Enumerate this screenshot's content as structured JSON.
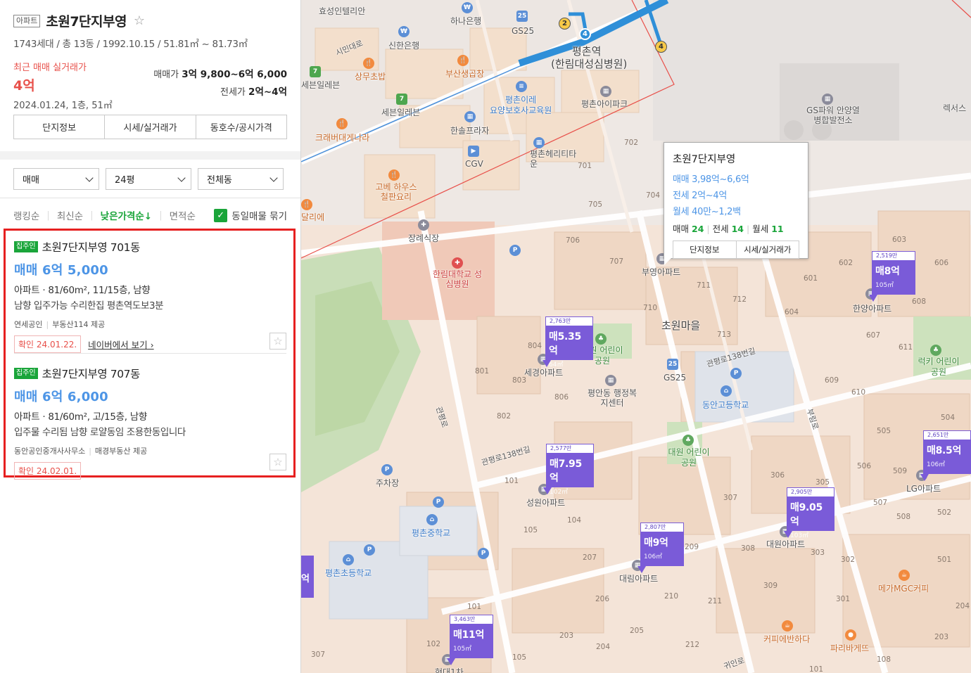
{
  "complex": {
    "type_badge": "아파트",
    "name": "초원7단지부영",
    "meta": "1743세대 / 총 13동 / 1992.10.15 / 51.81㎡ ~ 81.73㎡",
    "recent_label": "최근 매매 실거래가",
    "recent_price": "4억",
    "recent_date": "2024.01.24, 1층, 51㎡",
    "sale_label": "매매가",
    "sale_range": "3억 9,800~6억 6,000",
    "jeonse_label": "전세가",
    "jeonse_range": "2억~4억"
  },
  "tabs": [
    "단지정보",
    "시세/실거래가",
    "동호수/공시가격"
  ],
  "filters": {
    "deal": "매매",
    "size": "24평",
    "building": "전체동"
  },
  "sort": {
    "items": [
      "랭킹순",
      "최신순",
      "낮은가격순↓",
      "면적순"
    ],
    "active_index": 2,
    "same_listing_label": "동일매물 묶기"
  },
  "listings": [
    {
      "badge": "집주인",
      "title": "초원7단지부영 701동",
      "price": "매매 6억 5,000",
      "spec": "아파트 · 81/60m², 11/15층, 남향",
      "desc": "남향 입주가능 수리한집 평촌역도보3분",
      "agent": "연세공인",
      "provider": "부동산114 제공",
      "confirmed": "확인 24.01.22.",
      "link": "네이버에서 보기 ›"
    },
    {
      "badge": "집주인",
      "title": "초원7단지부영 707동",
      "price": "매매 6억 6,000",
      "spec": "아파트 · 81/60m², 고/15층, 남향",
      "desc": "입주물 수리됨 남향 로얄동임 조용한동입니다",
      "agent": "동안공인중개사사무소",
      "provider": "매경부동산 제공",
      "confirmed": "확인 24.02.01.",
      "link": ""
    }
  ],
  "popup": {
    "title": "초원7단지부영",
    "sale": "매매 3,98억~6,6억",
    "jeonse": "전세 2억~4억",
    "monthly": "월세 40만~1,2백",
    "sale_count_label": "매매",
    "sale_count": "24",
    "jeonse_count_label": "전세",
    "jeonse_count": "14",
    "monthly_count_label": "월세",
    "monthly_count": "11",
    "btn_info": "단지정보",
    "btn_price": "시세/실거래가"
  },
  "markers": [
    {
      "count": "2,763만",
      "price": "매5.35억",
      "area": "64㎡"
    },
    {
      "count": "2,577만",
      "price": "매7.95억",
      "area": "102㎡"
    },
    {
      "count": "2,807만",
      "price": "매9억",
      "area": "106㎡"
    },
    {
      "count": "2,905만",
      "price": "매9.05억",
      "area": "103㎡"
    },
    {
      "count": "2,519만",
      "price": "매8억",
      "area": "105㎡"
    },
    {
      "count": "2,651만",
      "price": "매8.5억",
      "area": "106㎡"
    },
    {
      "count": "3,463만",
      "price": "매11억",
      "area": "105㎡"
    }
  ],
  "map_labels": {
    "hyosung": "효성인텔리안",
    "hana": "하나은행",
    "gs25_top": "GS25",
    "pyeongchon_station": "평촌역",
    "hospital_station": "(한림대성심병원)",
    "simin": "시민대로",
    "shinhan": "신한은행",
    "sangmu": "상무초밥",
    "busan": "부산생곱창",
    "seven_left": "세븐일레븐",
    "seven_mid": "세븐일레븐",
    "pyeongchon_ire": "평촌이레",
    "nursing": "요양보호사교육원",
    "pyeongchon_ipark": "평촌아이파크",
    "crab": "크래버대게나라",
    "hansol": "한솔프라자",
    "cgv": "CGV",
    "pyeongchon_heritage": "평촌헤리티타운",
    "gobae": "고베 하우스 철판요리",
    "gspower": "GS파워 안양열병합발전소",
    "rexs": "렉서스",
    "jangrye": "장례식장",
    "hallym": "한림대학교 성심병원",
    "buyoung": "부영아파트",
    "chowon_village": "초원마을",
    "hanyang": "한양아파트",
    "segyeong": "세경아파트",
    "chowon_kinder": "초원 어린이공원",
    "gs25_mid": "GS25",
    "gwanpyeong138_a": "관평로138번길",
    "gwanpyeong138_b": "관평로138번길",
    "pyeongan": "평안동 행정복지센터",
    "dongan_high": "동안고등학교",
    "lucky": "럭키 어린이공원",
    "daewon_park": "대원 어린이공원",
    "seongwon": "성원아파트",
    "lg": "LG아파트",
    "daewon_apt": "대원아파트",
    "parking": "주차장",
    "pyeongchon_middle": "평촌중학교",
    "pyeongchon_elem": "평촌초등학교",
    "daerim": "대림아파트",
    "mega": "메가MGC커피",
    "coffee": "커피에반하다",
    "paris": "파리바게뜨",
    "gwanin": "귀인로",
    "gwanpyeong": "관평로",
    "bulim": "부림로",
    "hyeondae": "현대1차",
    "dalle": "달리에"
  },
  "colors": {
    "accent_green": "#1aa53a",
    "price_blue": "#4d95e6",
    "marker_purple": "#7a5bd8",
    "subway_blue": "#2f8fd8",
    "highlight_red": "#e62020"
  }
}
